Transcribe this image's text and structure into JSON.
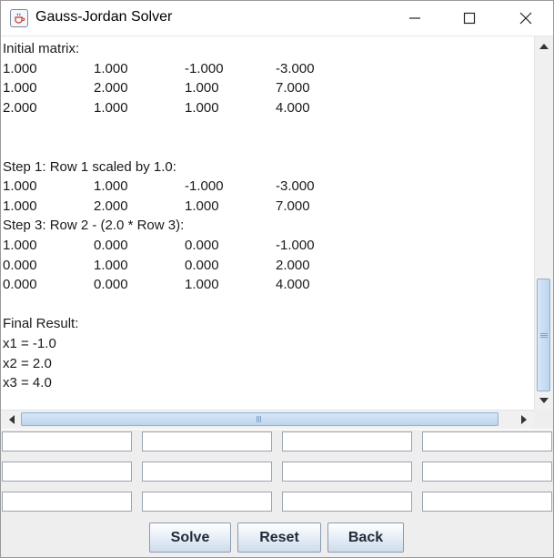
{
  "window": {
    "title": "Gauss-Jordan Solver",
    "icon": "java-cup-icon",
    "controls": {
      "minimize": "minimize-icon",
      "maximize": "maximize-icon",
      "close": "close-icon"
    }
  },
  "output": {
    "lines": [
      {
        "type": "text",
        "text": "Initial matrix:"
      },
      {
        "type": "row",
        "cells": [
          "1.000",
          "1.000",
          "-1.000",
          "-3.000"
        ]
      },
      {
        "type": "row",
        "cells": [
          "1.000",
          "2.000",
          "1.000",
          "7.000"
        ]
      },
      {
        "type": "row",
        "cells": [
          "2.000",
          "1.000",
          "1.000",
          "4.000"
        ]
      },
      {
        "type": "blank"
      },
      {
        "type": "blank"
      },
      {
        "type": "text",
        "text": "Step 1: Row 1 scaled by 1.0:"
      },
      {
        "type": "row",
        "cells": [
          "1.000",
          "1.000",
          "-1.000",
          "-3.000"
        ]
      },
      {
        "type": "row",
        "cells": [
          "1.000",
          "2.000",
          "1.000",
          "7.000"
        ]
      },
      {
        "type": "text",
        "text": "Step 3: Row 2 - (2.0 * Row 3):"
      },
      {
        "type": "row",
        "cells": [
          "1.000",
          "0.000",
          "0.000",
          "-1.000"
        ]
      },
      {
        "type": "row",
        "cells": [
          "0.000",
          "1.000",
          "0.000",
          "2.000"
        ]
      },
      {
        "type": "row",
        "cells": [
          "0.000",
          "0.000",
          "1.000",
          "4.000"
        ]
      },
      {
        "type": "blank"
      },
      {
        "type": "text",
        "text": "Final Result:"
      },
      {
        "type": "text",
        "text": "x1 = -1.0"
      },
      {
        "type": "text",
        "text": "x2 = 2.0"
      },
      {
        "type": "text",
        "text": "x3 = 4.0"
      }
    ]
  },
  "scrollbars": {
    "vertical": {
      "up": "arrow-up-icon",
      "down": "arrow-down-icon",
      "position": 0.92
    },
    "horizontal": {
      "left": "arrow-left-icon",
      "right": "arrow-right-icon",
      "position": 0.0
    }
  },
  "inputs": {
    "rows": [
      [
        "",
        "",
        "",
        ""
      ],
      [
        "",
        "",
        "",
        ""
      ],
      [
        "",
        "",
        "",
        ""
      ]
    ]
  },
  "buttons": {
    "solve": "Solve",
    "reset": "Reset",
    "back": "Back"
  },
  "colors": {
    "window_bg": "#eeeeee",
    "scroll_thumb": "#c8dcf0",
    "button_text": "#1f2b3a"
  }
}
